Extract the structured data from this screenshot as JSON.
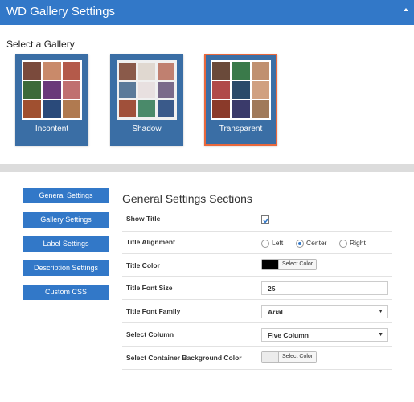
{
  "header": {
    "title": "WD Gallery Settings",
    "collapse_icon": "caret-up-icon"
  },
  "gallery": {
    "label": "Select a Gallery",
    "cards": [
      {
        "name": "Incontent",
        "selected": false
      },
      {
        "name": "Shadow",
        "selected": false
      },
      {
        "name": "Transparent",
        "selected": true
      }
    ]
  },
  "sidebar": {
    "items": [
      {
        "label": "General Settings"
      },
      {
        "label": "Gallery Settings"
      },
      {
        "label": "Label Settings"
      },
      {
        "label": "Description Settings"
      },
      {
        "label": "Custom CSS"
      }
    ]
  },
  "settings": {
    "title": "General Settings Sections",
    "show_title": {
      "label": "Show Title",
      "checked": true
    },
    "title_alignment": {
      "label": "Title Alignment",
      "options": [
        "Left",
        "Center",
        "Right"
      ],
      "selected": "Center"
    },
    "title_color": {
      "label": "Title Color",
      "swatch": "#000000",
      "button": "Select Color"
    },
    "title_font_size": {
      "label": "Title Font Size",
      "value": "25"
    },
    "title_font_family": {
      "label": "Title Font Family",
      "value": "Arial"
    },
    "select_column": {
      "label": "Select Column",
      "value": "Five Column"
    },
    "container_bg": {
      "label": "Select Container Background Color",
      "swatch": "#ececec",
      "button": "Select Color"
    }
  },
  "colors": {
    "header": "#3278c8",
    "card": "#3a6ea5",
    "selected_border": "#e8683c",
    "nav_button": "#3278c8"
  }
}
